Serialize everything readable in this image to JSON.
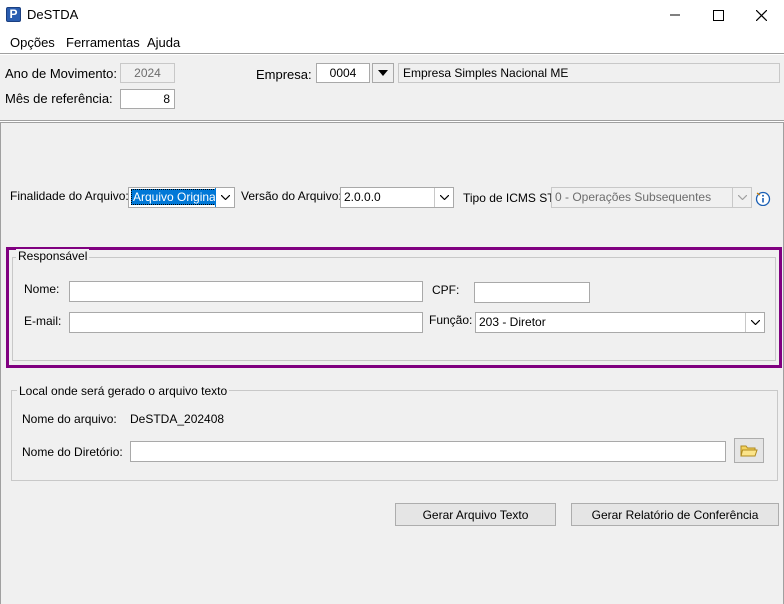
{
  "window": {
    "title": "DeSTDA",
    "logo_letter": "P"
  },
  "menu": [
    "Opções",
    "Ferramentas",
    "Ajuda"
  ],
  "header": {
    "ano_label": "Ano de Movimento:",
    "ano_value": "2024",
    "mes_label": "Mês de referência:",
    "mes_value": "8",
    "empresa_label": "Empresa:",
    "empresa_code": "0004",
    "empresa_name": "Empresa Simples Nacional ME"
  },
  "options": {
    "finalidade_label": "Finalidade do Arquivo:",
    "finalidade_value": "Arquivo Original",
    "versao_label": "Versão do Arquivo:",
    "versao_value": "2.0.0.0",
    "icms_label": "Tipo de ICMS ST:",
    "icms_value": "0 - Operações Subsequentes"
  },
  "responsavel": {
    "title": "Responsável",
    "nome_label": "Nome:",
    "nome_value": "",
    "cpf_label": "CPF:",
    "cpf_value": "",
    "email_label": "E-mail:",
    "email_value": "",
    "funcao_label": "Função:",
    "funcao_value": "203 - Diretor",
    "highlight_color": "#800080"
  },
  "local": {
    "title": "Local onde será gerado o arquivo texto",
    "nome_arquivo_label": "Nome do arquivo:",
    "nome_arquivo_value": "DeSTDA_202408",
    "diretorio_label": "Nome do Diretório:",
    "diretorio_value": ""
  },
  "buttons": {
    "gerar_texto": "Gerar Arquivo Texto",
    "gerar_relatorio": "Gerar Relatório de Conferência"
  }
}
